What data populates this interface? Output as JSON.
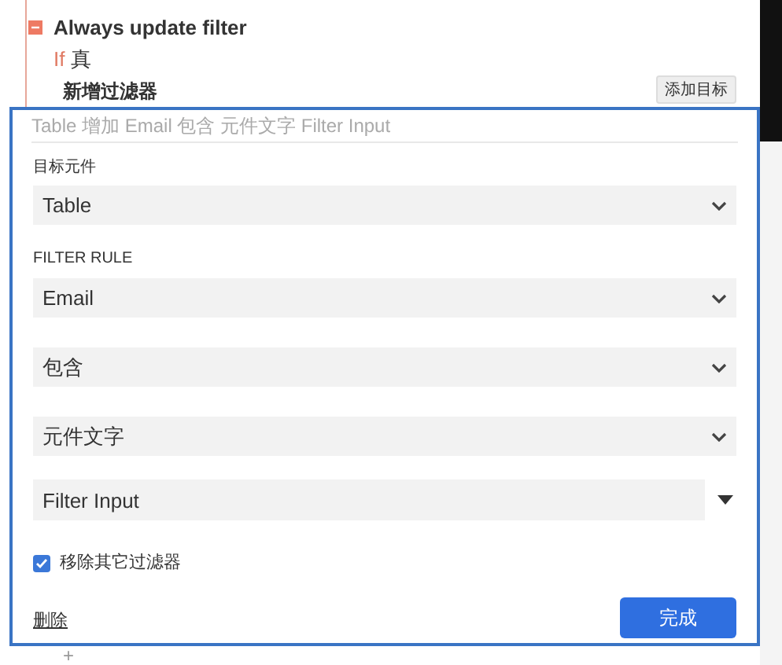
{
  "rule": {
    "title": "Always update filter",
    "expanded": true,
    "condition_keyword": "If",
    "condition_value": "真"
  },
  "section": {
    "title": "新增过滤器",
    "button": "添加目标"
  },
  "dialog": {
    "summary_placeholder": "Table 增加 Email 包含 元件文字 Filter Input",
    "target_label": "目标元件",
    "target_value": "Table",
    "rule_label": "FILTER RULE",
    "selects": [
      {
        "value": "Email"
      },
      {
        "value": "包含"
      },
      {
        "value": "元件文字"
      }
    ],
    "filter_input": "Filter Input",
    "remove_others": {
      "label": "移除其它过滤器",
      "checked": true
    },
    "delete_link": "删除",
    "done_button": "完成"
  },
  "add_symbol": "+"
}
